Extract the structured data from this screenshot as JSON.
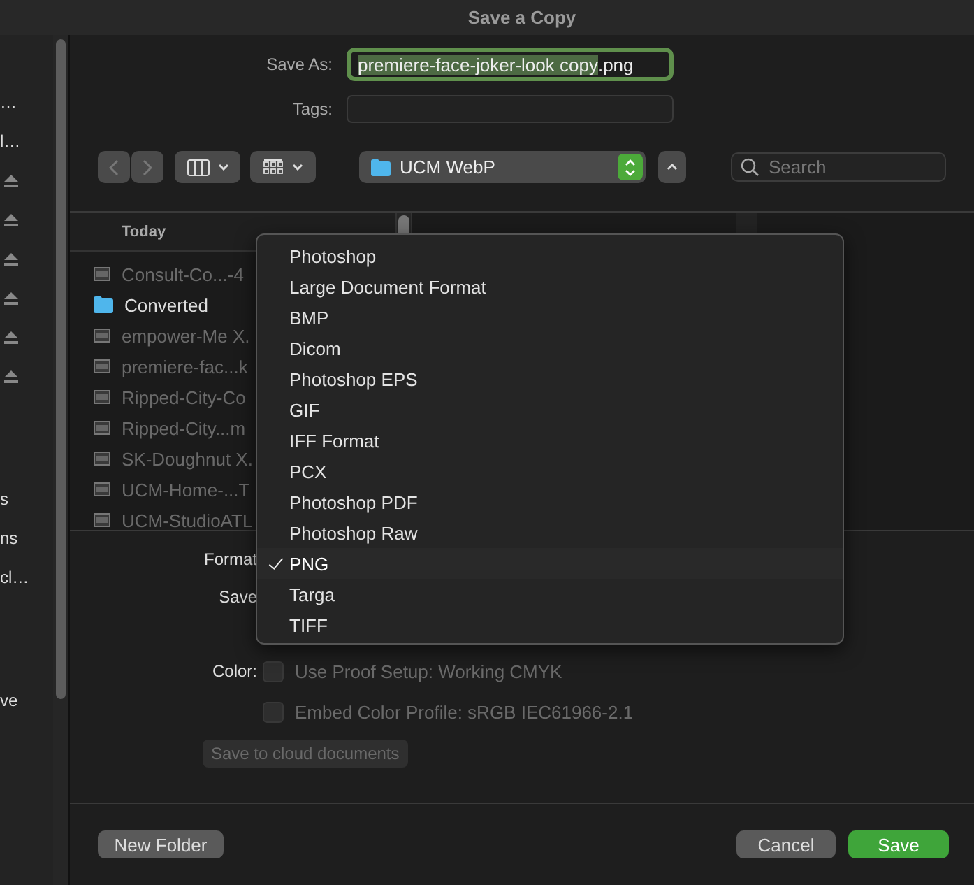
{
  "window": {
    "title": "Save a Copy"
  },
  "sidebar": {
    "sections": [
      {
        "items": [
          {
            "kind": "text",
            "label": "…"
          },
          {
            "kind": "text",
            "label": "l…"
          },
          {
            "kind": "eject"
          },
          {
            "kind": "eject"
          },
          {
            "kind": "eject"
          },
          {
            "kind": "eject"
          },
          {
            "kind": "eject"
          },
          {
            "kind": "eject"
          }
        ]
      },
      {
        "items": [
          {
            "kind": "text",
            "label": "s"
          },
          {
            "kind": "text",
            "label": "ns"
          },
          {
            "kind": "text",
            "label": "cl…"
          }
        ]
      },
      {
        "items": [
          {
            "kind": "text",
            "label": "ve"
          }
        ]
      }
    ]
  },
  "save_as": {
    "label": "Save As:",
    "value_parts": [
      {
        "text": "premiere-face-joker-look copy",
        "selected": true
      },
      {
        "text": ".png",
        "selected": false
      }
    ]
  },
  "tags": {
    "label": "Tags:"
  },
  "location": {
    "label": "UCM WebP"
  },
  "search": {
    "placeholder": "Search"
  },
  "browser": {
    "header": "Today",
    "files": [
      {
        "kind": "file",
        "name": "Consult-Co...-4",
        "disabled": true
      },
      {
        "kind": "folder",
        "name": "Converted",
        "disabled": false
      },
      {
        "kind": "file",
        "name": "empower-Me X.",
        "disabled": true
      },
      {
        "kind": "file",
        "name": "premiere-fac...k",
        "disabled": true
      },
      {
        "kind": "file",
        "name": "Ripped-City-Co",
        "disabled": true
      },
      {
        "kind": "file",
        "name": "Ripped-City...m",
        "disabled": true
      },
      {
        "kind": "file",
        "name": "SK-Doughnut X.",
        "disabled": true
      },
      {
        "kind": "file",
        "name": "UCM-Home-...T",
        "disabled": true
      },
      {
        "kind": "file",
        "name": "UCM-StudioATL",
        "disabled": true
      }
    ]
  },
  "options": {
    "format_label": "Format",
    "save_label": "Save",
    "color_label": "Color:",
    "color_options": [
      {
        "label": "Use Proof Setup:  Working CMYK",
        "checked": false,
        "disabled": true
      },
      {
        "label": "Embed Color Profile:  sRGB IEC61966-2.1",
        "checked": false,
        "disabled": true
      }
    ],
    "cloud_button": {
      "label": "Save to cloud documents",
      "disabled": true
    }
  },
  "format_menu": [
    {
      "label": "Photoshop",
      "selected": false
    },
    {
      "label": "Large Document Format",
      "selected": false
    },
    {
      "label": "BMP",
      "selected": false
    },
    {
      "label": "Dicom",
      "selected": false
    },
    {
      "label": "Photoshop EPS",
      "selected": false
    },
    {
      "label": "GIF",
      "selected": false
    },
    {
      "label": "IFF Format",
      "selected": false
    },
    {
      "label": "PCX",
      "selected": false
    },
    {
      "label": "Photoshop PDF",
      "selected": false
    },
    {
      "label": "Photoshop Raw",
      "selected": false
    },
    {
      "label": "PNG",
      "selected": true
    },
    {
      "label": "Targa",
      "selected": false
    },
    {
      "label": "TIFF",
      "selected": false
    }
  ],
  "buttons": {
    "new_folder": "New Folder",
    "cancel": "Cancel",
    "save": "Save"
  }
}
